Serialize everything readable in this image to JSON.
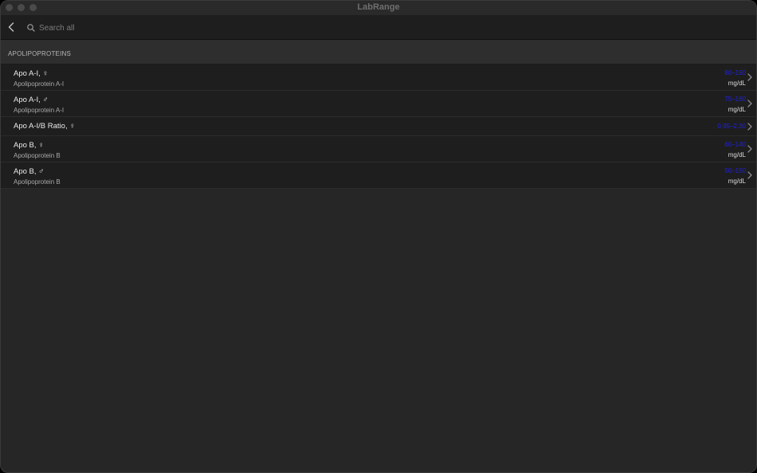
{
  "window": {
    "title": "LabRange"
  },
  "toolbar": {
    "search_placeholder": "Search all"
  },
  "section": {
    "title": "APOLIPOPROTEINS"
  },
  "items": [
    {
      "name": "Apo A-I, ♀",
      "subtitle": "Apolipoprotein A-I",
      "range": "80–190",
      "unit": "mg/dL"
    },
    {
      "name": "Apo A-I, ♂",
      "subtitle": "Apolipoprotein A-I",
      "range": "75–160",
      "unit": "mg/dL"
    },
    {
      "name": "Apo A-I/B Ratio, ♀",
      "subtitle": "",
      "range": "0.95–2.30",
      "unit": ""
    },
    {
      "name": "Apo B, ♀",
      "subtitle": "Apolipoprotein B",
      "range": "60–140",
      "unit": "mg/dL"
    },
    {
      "name": "Apo B, ♂",
      "subtitle": "Apolipoprotein B",
      "range": "50–150",
      "unit": "mg/dL"
    }
  ],
  "colors": {
    "range_text": "#1f1ff0",
    "window_bg": "#262626",
    "row_bg": "#1e1e1e"
  },
  "icons": [
    "chevron-left-icon",
    "search-icon",
    "chevron-right-icon"
  ]
}
